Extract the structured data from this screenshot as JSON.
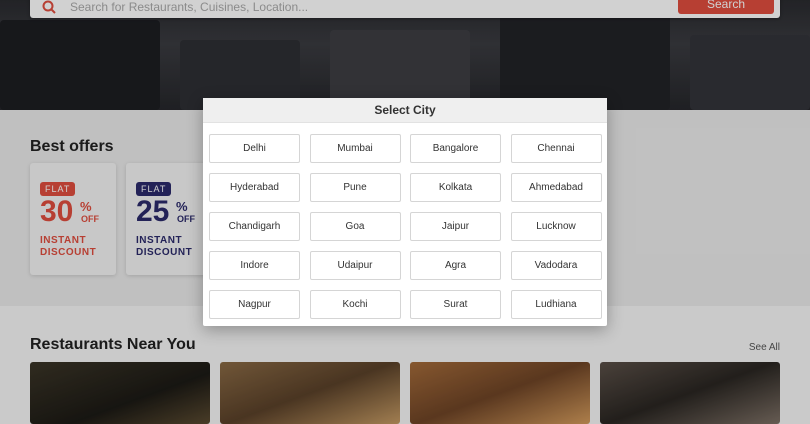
{
  "search": {
    "placeholder": "Search for Restaurants, Cuisines, Location...",
    "button_label": "Search"
  },
  "offers": {
    "title": "Best offers",
    "cards": [
      {
        "badge": "FLAT",
        "number": "30",
        "percent": "%",
        "off": "OFF",
        "line1": "INSTANT",
        "line2": "DISCOUNT",
        "color": "#e04e3f"
      },
      {
        "badge": "FLAT",
        "number": "25",
        "percent": "%",
        "off": "OFF",
        "line1": "INSTANT",
        "line2": "DISCOUNT",
        "color": "#2b2a6b"
      }
    ]
  },
  "restaurants": {
    "title": "Restaurants Near You",
    "see_all": "See All"
  },
  "modal": {
    "title": "Select City",
    "cities": [
      "Delhi",
      "Mumbai",
      "Bangalore",
      "Chennai",
      "Hyderabad",
      "Pune",
      "Kolkata",
      "Ahmedabad",
      "Chandigarh",
      "Goa",
      "Jaipur",
      "Lucknow",
      "Indore",
      "Udaipur",
      "Agra",
      "Vadodara",
      "Nagpur",
      "Kochi",
      "Surat",
      "Ludhiana"
    ]
  },
  "colors": {
    "accent": "#e04e3f",
    "navy": "#2b2a6b"
  }
}
